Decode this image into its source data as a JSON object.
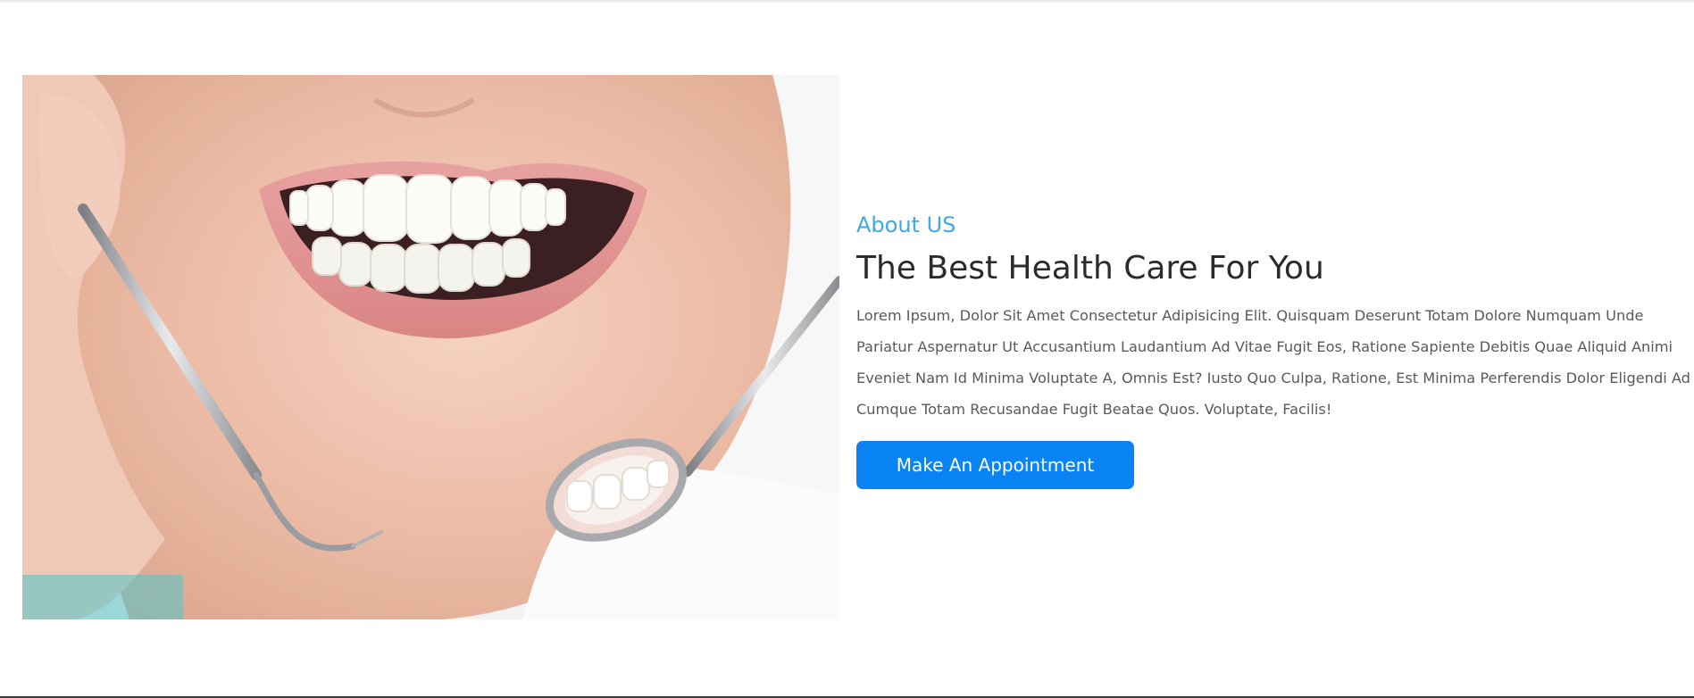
{
  "about": {
    "subtitle": "About US",
    "title": "The Best Health Care For You",
    "description": "Lorem Ipsum, Dolor Sit Amet Consectetur Adipisicing Elit. Quisquam Deserunt Totam Dolore Numquam Unde Pariatur Aspernatur Ut Accusantium Laudantium Ad Vitae Fugit Eos, Ratione Sapiente Debitis Quae Aliquid Animi Eveniet Nam Id Minima Voluptate A, Omnis Est? Iusto Quo Culpa, Ratione, Est Minima Perferendis Dolor Eligendi Ad Cumque Totam Recusandae Fugit Beatae Quos. Voluptate, Facilis!",
    "button_label": "Make An Appointment"
  },
  "photo": {
    "subject": "smiling-teeth-dental-tools"
  },
  "colors": {
    "accent": "#3fa9e6",
    "button": "#0a84f5",
    "heading": "#2b2b2b",
    "body_text": "#5a5a5a"
  }
}
